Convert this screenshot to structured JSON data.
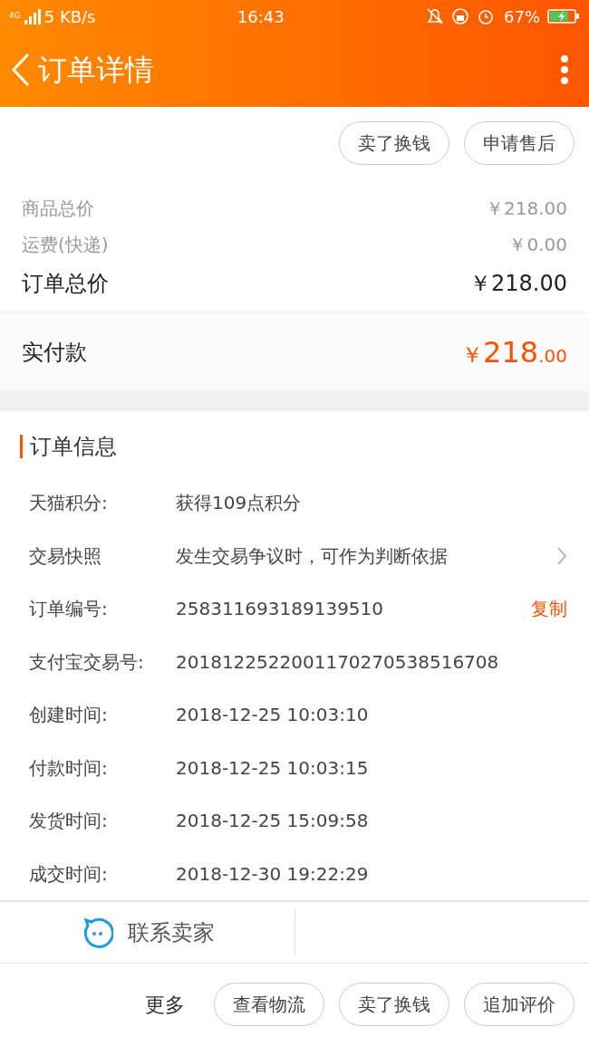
{
  "status_bar": {
    "network": "4G",
    "speed": "5 KB/s",
    "time": "16:43",
    "battery": "67%",
    "charging": true
  },
  "header": {
    "title": "订单详情"
  },
  "top_actions": [
    "卖了换钱",
    "申请售后"
  ],
  "prices": [
    {
      "kind": "minor",
      "label": "商品总价",
      "value": "￥218.00"
    },
    {
      "kind": "minor",
      "label": "运费(快递)",
      "value": "￥0.00"
    },
    {
      "kind": "major",
      "label": "订单总价",
      "value": "￥218.00"
    }
  ],
  "paid": {
    "label": "实付款",
    "currency": "￥",
    "integer": "218",
    "decimal": ".00"
  },
  "order_info": {
    "title": "订单信息",
    "rows": [
      {
        "label": "天猫积分:",
        "value": "获得109点积分"
      },
      {
        "label": "交易快照",
        "value": "发生交易争议时，可作为判断依据",
        "chevron": true
      },
      {
        "label": "订单编号:",
        "value": "258311693189139510",
        "action": "复制"
      },
      {
        "label": "支付宝交易号:",
        "value": "2018122522001170270538516708"
      },
      {
        "label": "创建时间:",
        "value": "2018-12-25 10:03:10"
      },
      {
        "label": "付款时间:",
        "value": "2018-12-25 10:03:15"
      },
      {
        "label": "发货时间:",
        "value": "2018-12-25 15:09:58"
      },
      {
        "label": "成交时间:",
        "value": "2018-12-30 19:22:29"
      }
    ]
  },
  "contact": {
    "label": "联系卖家"
  },
  "bottom_bar": {
    "more": "更多",
    "buttons": [
      "查看物流",
      "卖了换钱",
      "追加评价"
    ]
  }
}
